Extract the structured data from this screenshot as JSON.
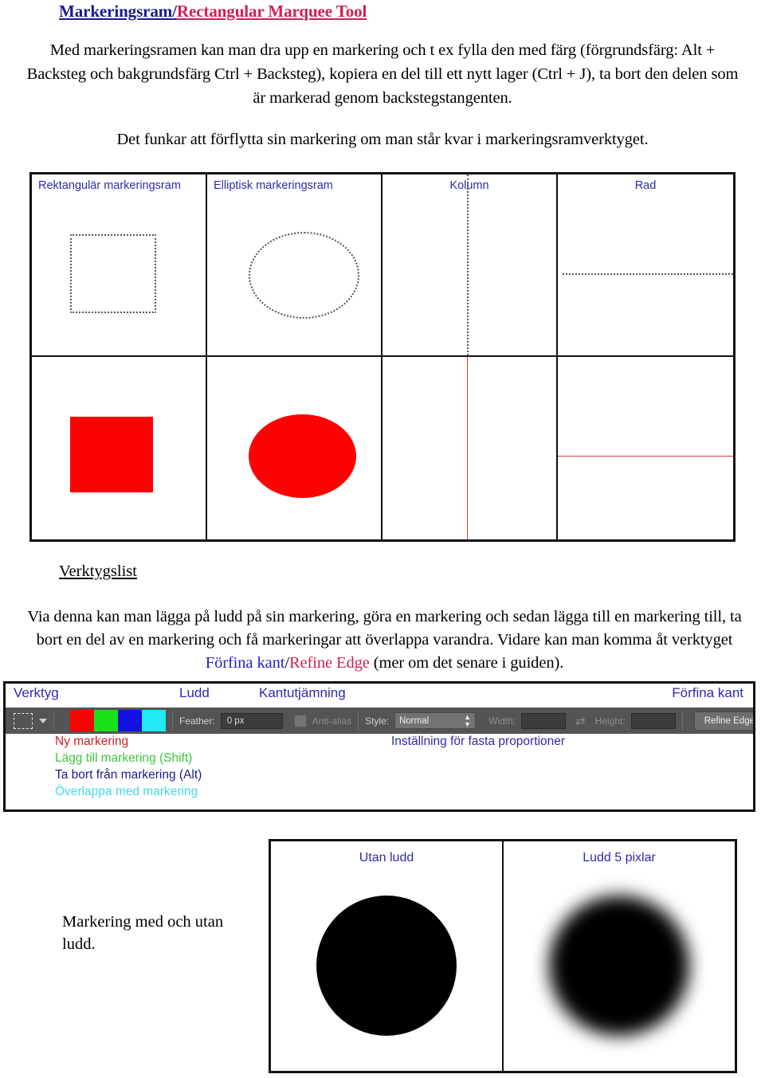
{
  "title": {
    "swedish": "Markeringsram",
    "separator": "/",
    "english": "Rectangular Marquee Tool"
  },
  "paragraphs": {
    "intro": "Med markeringsramen kan man dra upp en markering och t ex fylla den med färg (förgrundsfärg: Alt + Backsteg och bakgrundsfärg Ctrl + Backsteg), kopiera en del till ett nytt lager (Ctrl + J), ta bort den delen som är markerad genom backstegstangenten.",
    "move": "Det funkar att förflytta sin markering om man står kvar i markeringsramverktyget."
  },
  "marquee_grid": {
    "cells": [
      {
        "label": "Rektangulär markeringsram",
        "shape": "dotted-rectangle"
      },
      {
        "label": "Elliptisk markeringsram",
        "shape": "dotted-ellipse"
      },
      {
        "label": "Kolumn",
        "shape": "dotted-vertical-line"
      },
      {
        "label": "Rad",
        "shape": "dotted-horizontal-line"
      }
    ],
    "filled_row": [
      {
        "shape": "filled-rectangle",
        "color": "#fc0303"
      },
      {
        "shape": "filled-ellipse",
        "color": "#fc0303"
      },
      {
        "shape": "thin-vertical-line",
        "color": "#c94040"
      },
      {
        "shape": "thin-horizontal-line",
        "color": "#c94040"
      }
    ]
  },
  "toolbar_section": {
    "heading": "Verktygslist",
    "body_part1": "Via denna kan man lägga på ludd på sin markering, göra en markering och sedan lägga till en markering till, ta bort en del av en markering och få markeringar att överlappa varandra. Vidare kan man komma åt verktyget ",
    "link_swedish": "Förfina kant",
    "link_separator": "/",
    "link_english": "Refine Edge",
    "body_part2": " (mer om det senare i guiden)."
  },
  "ps_toolbar": {
    "captions": {
      "verktyg": "Verktyg",
      "ludd": "Ludd",
      "kantutjamning": "Kantutjämning",
      "forfina_kant": "Förfina kant"
    },
    "tool_icon": "rectangular-marquee-icon",
    "dropdown_icon": "chevron-down-icon",
    "selection_mode_swatches": [
      {
        "name": "new-selection",
        "color": "#fc0000"
      },
      {
        "name": "add-to-selection",
        "color": "#18e218"
      },
      {
        "name": "subtract-from-selection",
        "color": "#1010e0"
      },
      {
        "name": "intersect-with-selection",
        "color": "#21e9f5"
      }
    ],
    "feather_label": "Feather:",
    "feather_value": "0 px",
    "antialias_label": "Anti-alias",
    "antialias_checked": false,
    "style_label": "Style:",
    "style_value": "Normal",
    "width_label": "Width:",
    "width_value": "",
    "swap_icon": "swap-arrows-icon",
    "height_label": "Height:",
    "height_value": "",
    "refine_edge_button": "Refine Edge..."
  },
  "annotations": {
    "new_selection": "Ny markering",
    "add_selection": "Lägg till markering  (Shift)",
    "subtract_selection": "Ta bort från markering (Alt)",
    "intersect_selection": "Överlappa med markering",
    "fixed_proportions": "Inställning för fasta proportioner"
  },
  "feather_comparison": {
    "left_label": "Utan ludd",
    "right_label": "Ludd 5 pixlar",
    "caption": "Markering med och utan ludd."
  },
  "colors": {
    "title_swedish": "#1a1a8c",
    "title_english": "#d02050",
    "annotation_blue": "#2b2bb0",
    "shape_red": "#fc0303"
  }
}
